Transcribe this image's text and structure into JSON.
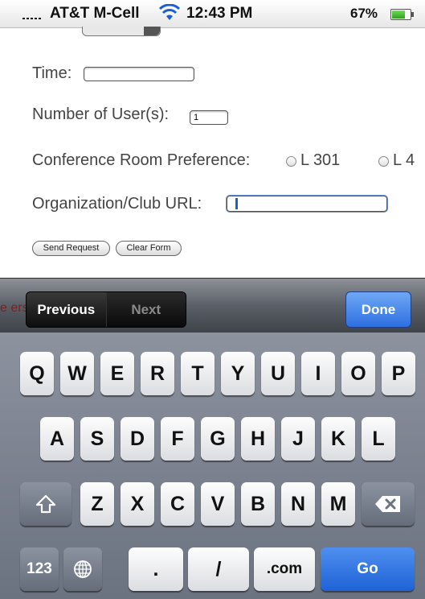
{
  "status_bar": {
    "carrier": "AT&T M-Cell",
    "time": "12:43 PM",
    "battery": "67%",
    "battery_level": 0.67,
    "signal_icon": "signal-bars-icon",
    "wifi_icon": "wifi-icon",
    "battery_icon": "battery-icon"
  },
  "form": {
    "time_label": "Time:",
    "time_value": "",
    "users_label": "Number of User(s):",
    "users_value": "1",
    "room_label": "Conference Room Preference:",
    "room_options": [
      "L 301",
      "L 4"
    ],
    "url_label": "Organization/Club URL:",
    "url_value": "",
    "send_label": "Send Request",
    "clear_label": "Clear Form"
  },
  "toolbar": {
    "background_text": "e                        ersity | Copyright Compl",
    "previous": "Previous",
    "next": "Next",
    "done": "Done"
  },
  "keyboard": {
    "row1": [
      "Q",
      "W",
      "E",
      "R",
      "T",
      "Y",
      "U",
      "I",
      "O",
      "P"
    ],
    "row2": [
      "A",
      "S",
      "D",
      "F",
      "G",
      "H",
      "J",
      "K",
      "L"
    ],
    "row3": [
      "Z",
      "X",
      "C",
      "V",
      "B",
      "N",
      "M"
    ],
    "numbers_key": "123",
    "dot_key": ".",
    "slash_key": "/",
    "dotcom_key": ".com",
    "go_key": "Go",
    "shift_icon": "shift-icon",
    "delete_icon": "delete-icon",
    "globe_icon": "globe-icon"
  },
  "colors": {
    "accent_blue": "#2e6fe0",
    "link_red": "#7a1a1a"
  }
}
